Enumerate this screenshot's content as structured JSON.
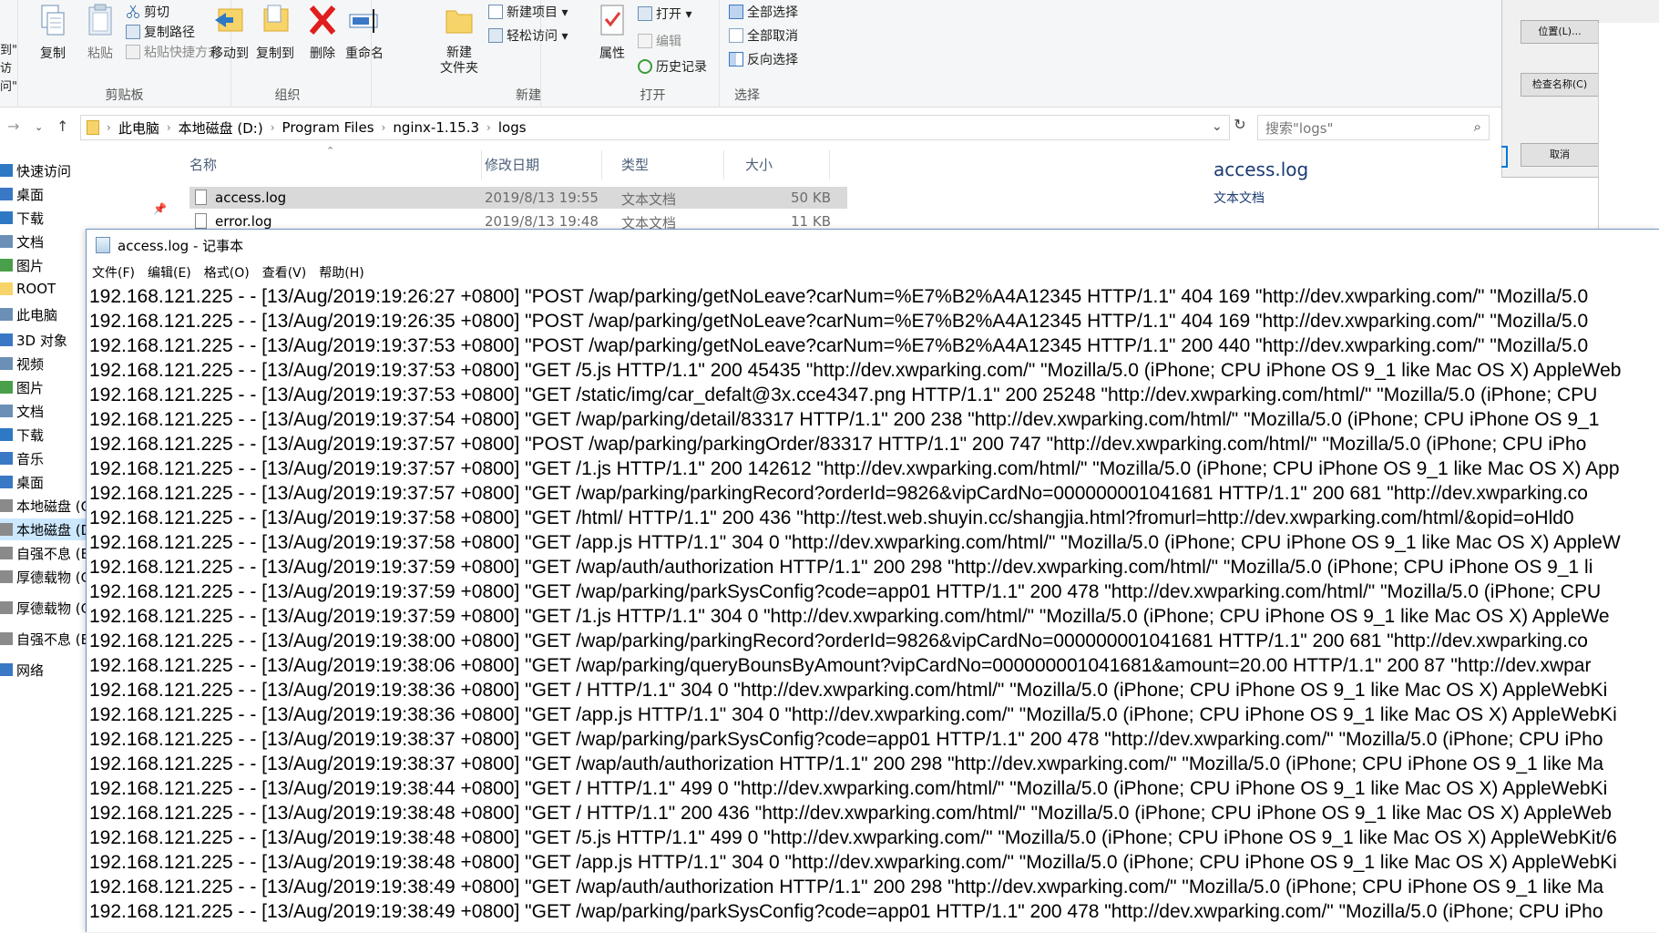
{
  "ribbon": {
    "quick_access_partial": [
      "到\"",
      "访问\""
    ],
    "clipboard": {
      "copy": "复制",
      "paste": "粘贴",
      "cut": "剪切",
      "copy_path": "复制路径",
      "paste_shortcut": "粘贴快捷方式",
      "label": "剪贴板"
    },
    "organize": {
      "move_to": "移动到",
      "copy_to": "复制到",
      "delete": "删除",
      "rename": "重命名",
      "label": "组织"
    },
    "new": {
      "new_folder": "新建\n文件夹",
      "new_item": "新建项目 ▾",
      "easy_access": "轻松访问 ▾",
      "label": "新建"
    },
    "open": {
      "properties": "属性",
      "open": "打开 ▾",
      "edit": "编辑",
      "history": "历史记录",
      "label": "打开"
    },
    "select": {
      "select_all": "全部选择",
      "select_none": "全部取消",
      "invert": "反向选择",
      "label": "选择"
    }
  },
  "address": {
    "crumbs": [
      "此电脑",
      "本地磁盘 (D:)",
      "Program Files",
      "nginx-1.15.3",
      "logs"
    ],
    "search_placeholder": "搜索\"logs\""
  },
  "sidebar": {
    "items": [
      "快速访问",
      "桌面",
      "下载",
      "文档",
      "图片",
      "ROOT",
      "此电脑",
      "3D 对象",
      "视频",
      "图片",
      "文档",
      "下载",
      "音乐",
      "桌面",
      "本地磁盘 (C",
      "本地磁盘 (D",
      "自强不息 (E",
      "厚德载物 (G",
      "厚德载物 (G:",
      "自强不息 (E:)",
      "网络"
    ]
  },
  "files": {
    "headers": {
      "name": "名称",
      "date": "修改日期",
      "type": "类型",
      "size": "大小"
    },
    "rows": [
      {
        "name": "access.log",
        "date": "2019/8/13 19:55",
        "type": "文本文档",
        "size": "50 KB"
      },
      {
        "name": "error.log",
        "date": "2019/8/13 19:48",
        "type": "文本文档",
        "size": "11 KB"
      }
    ]
  },
  "preview": {
    "title": "access.log",
    "type": "文本文档"
  },
  "dialog": {
    "location": "位置(L)...",
    "check_names": "检查名称(C)",
    "cancel": "取消"
  },
  "notepad": {
    "title": "access.log - 记事本",
    "menus": [
      "文件(F)",
      "编辑(E)",
      "格式(O)",
      "查看(V)",
      "帮助(H)"
    ],
    "lines": [
      "192.168.121.225 - - [13/Aug/2019:19:26:27 +0800] \"POST /wap/parking/getNoLeave?carNum=%E7%B2%A4A12345 HTTP/1.1\" 404 169 \"http://dev.xwparking.com/\" \"Mozilla/5.0",
      "192.168.121.225 - - [13/Aug/2019:19:26:35 +0800] \"POST /wap/parking/getNoLeave?carNum=%E7%B2%A4A12345 HTTP/1.1\" 404 169 \"http://dev.xwparking.com/\" \"Mozilla/5.0",
      "192.168.121.225 - - [13/Aug/2019:19:37:53 +0800] \"POST /wap/parking/getNoLeave?carNum=%E7%B2%A4A12345 HTTP/1.1\" 200 440 \"http://dev.xwparking.com/\" \"Mozilla/5.0",
      "192.168.121.225 - - [13/Aug/2019:19:37:53 +0800] \"GET /5.js HTTP/1.1\" 200 45435 \"http://dev.xwparking.com/\" \"Mozilla/5.0 (iPhone; CPU iPhone OS 9_1 like Mac OS X) AppleWeb",
      "192.168.121.225 - - [13/Aug/2019:19:37:53 +0800] \"GET /static/img/car_defalt@3x.cce4347.png HTTP/1.1\" 200 25248 \"http://dev.xwparking.com/html/\" \"Mozilla/5.0 (iPhone; CPU",
      "192.168.121.225 - - [13/Aug/2019:19:37:54 +0800] \"GET /wap/parking/detail/83317 HTTP/1.1\" 200 238 \"http://dev.xwparking.com/html/\" \"Mozilla/5.0 (iPhone; CPU iPhone OS 9_1",
      "192.168.121.225 - - [13/Aug/2019:19:37:57 +0800] \"POST /wap/parking/parkingOrder/83317 HTTP/1.1\" 200 747 \"http://dev.xwparking.com/html/\" \"Mozilla/5.0 (iPhone; CPU iPho",
      "192.168.121.225 - - [13/Aug/2019:19:37:57 +0800] \"GET /1.js HTTP/1.1\" 200 142612 \"http://dev.xwparking.com/html/\" \"Mozilla/5.0 (iPhone; CPU iPhone OS 9_1 like Mac OS X) App",
      "192.168.121.225 - - [13/Aug/2019:19:37:57 +0800] \"GET /wap/parking/parkingRecord?orderId=9826&vipCardNo=000000001041681 HTTP/1.1\" 200 681 \"http://dev.xwparking.co",
      "192.168.121.225 - - [13/Aug/2019:19:37:58 +0800] \"GET /html/ HTTP/1.1\" 200 436 \"http://test.web.shuyin.cc/shangjia.html?fromurl=http://dev.xwparking.com/html/&opid=oHld0",
      "192.168.121.225 - - [13/Aug/2019:19:37:58 +0800] \"GET /app.js HTTP/1.1\" 304 0 \"http://dev.xwparking.com/html/\" \"Mozilla/5.0 (iPhone; CPU iPhone OS 9_1 like Mac OS X) AppleW",
      "192.168.121.225 - - [13/Aug/2019:19:37:59 +0800] \"GET /wap/auth/authorization HTTP/1.1\" 200 298 \"http://dev.xwparking.com/html/\" \"Mozilla/5.0 (iPhone; CPU iPhone OS 9_1 li",
      "192.168.121.225 - - [13/Aug/2019:19:37:59 +0800] \"GET /wap/parking/parkSysConfig?code=app01 HTTP/1.1\" 200 478 \"http://dev.xwparking.com/html/\" \"Mozilla/5.0 (iPhone; CPU",
      "192.168.121.225 - - [13/Aug/2019:19:37:59 +0800] \"GET /1.js HTTP/1.1\" 304 0 \"http://dev.xwparking.com/html/\" \"Mozilla/5.0 (iPhone; CPU iPhone OS 9_1 like Mac OS X) AppleWe",
      "192.168.121.225 - - [13/Aug/2019:19:38:00 +0800] \"GET /wap/parking/parkingRecord?orderId=9826&vipCardNo=000000001041681 HTTP/1.1\" 200 681 \"http://dev.xwparking.co",
      "192.168.121.225 - - [13/Aug/2019:19:38:06 +0800] \"GET /wap/parking/queryBounsByAmount?vipCardNo=000000001041681&amount=20.00 HTTP/1.1\" 200 87 \"http://dev.xwpar",
      "192.168.121.225 - - [13/Aug/2019:19:38:36 +0800] \"GET / HTTP/1.1\" 304 0 \"http://dev.xwparking.com/html/\" \"Mozilla/5.0 (iPhone; CPU iPhone OS 9_1 like Mac OS X) AppleWebKi",
      "192.168.121.225 - - [13/Aug/2019:19:38:36 +0800] \"GET /app.js HTTP/1.1\" 304 0 \"http://dev.xwparking.com/\" \"Mozilla/5.0 (iPhone; CPU iPhone OS 9_1 like Mac OS X) AppleWebKi",
      "192.168.121.225 - - [13/Aug/2019:19:38:37 +0800] \"GET /wap/parking/parkSysConfig?code=app01 HTTP/1.1\" 200 478 \"http://dev.xwparking.com/\" \"Mozilla/5.0 (iPhone; CPU iPho",
      "192.168.121.225 - - [13/Aug/2019:19:38:37 +0800] \"GET /wap/auth/authorization HTTP/1.1\" 200 298 \"http://dev.xwparking.com/\" \"Mozilla/5.0 (iPhone; CPU iPhone OS 9_1 like Ma",
      "192.168.121.225 - - [13/Aug/2019:19:38:44 +0800] \"GET / HTTP/1.1\" 499 0 \"http://dev.xwparking.com/html/\" \"Mozilla/5.0 (iPhone; CPU iPhone OS 9_1 like Mac OS X) AppleWebKi",
      "192.168.121.225 - - [13/Aug/2019:19:38:48 +0800] \"GET / HTTP/1.1\" 200 436 \"http://dev.xwparking.com/html/\" \"Mozilla/5.0 (iPhone; CPU iPhone OS 9_1 like Mac OS X) AppleWeb",
      "192.168.121.225 - - [13/Aug/2019:19:38:48 +0800] \"GET /5.js HTTP/1.1\" 499 0 \"http://dev.xwparking.com/\" \"Mozilla/5.0 (iPhone; CPU iPhone OS 9_1 like Mac OS X) AppleWebKit/6",
      "192.168.121.225 - - [13/Aug/2019:19:38:48 +0800] \"GET /app.js HTTP/1.1\" 304 0 \"http://dev.xwparking.com/\" \"Mozilla/5.0 (iPhone; CPU iPhone OS 9_1 like Mac OS X) AppleWebKi",
      "192.168.121.225 - - [13/Aug/2019:19:38:49 +0800] \"GET /wap/auth/authorization HTTP/1.1\" 200 298 \"http://dev.xwparking.com/\" \"Mozilla/5.0 (iPhone; CPU iPhone OS 9_1 like Ma",
      "192.168.121.225 - - [13/Aug/2019:19:38:49 +0800] \"GET /wap/parking/parkSysConfig?code=app01 HTTP/1.1\" 200 478 \"http://dev.xwparking.com/\" \"Mozilla/5.0 (iPhone; CPU iPho"
    ]
  }
}
